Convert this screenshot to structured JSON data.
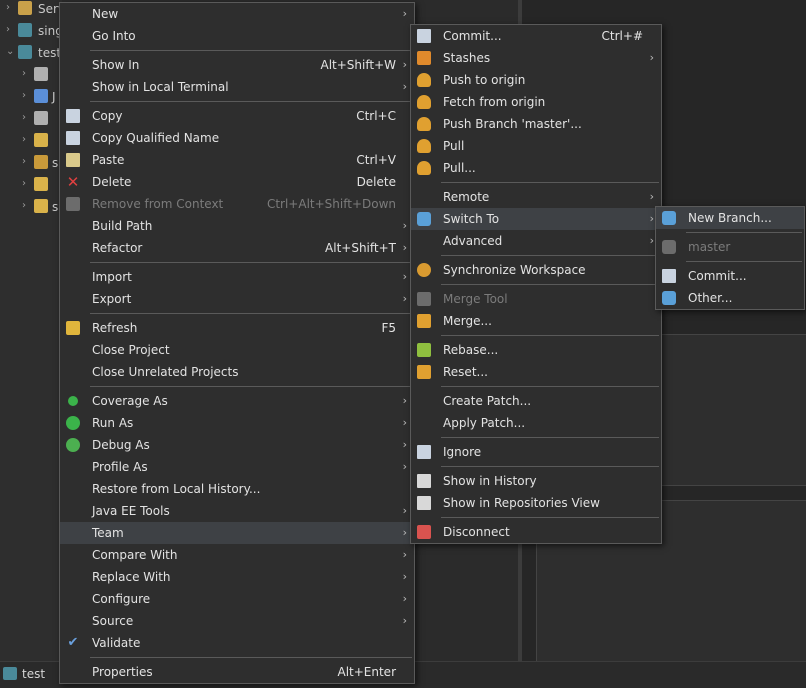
{
  "tree": [
    {
      "label": "Serv",
      "icon": "server-folder-icon"
    },
    {
      "label": "sing",
      "icon": "project-icon"
    },
    {
      "label": "test",
      "icon": "project-icon"
    },
    {
      "label": "",
      "icon": "library-icon"
    },
    {
      "label": "J",
      "icon": "java-icon"
    },
    {
      "label": "",
      "icon": "library-icon"
    },
    {
      "label": "",
      "icon": "folder-icon"
    },
    {
      "label": "s",
      "icon": "source-folder-icon"
    },
    {
      "label": "",
      "icon": "folder-icon"
    },
    {
      "label": "s",
      "icon": "folder-icon"
    }
  ],
  "status": {
    "label": "test"
  },
  "context_menu": {
    "groups": [
      [
        {
          "label": "New",
          "submenu": true
        },
        {
          "label": "Go Into"
        }
      ],
      [
        {
          "label": "Show In",
          "shortcut": "Alt+Shift+W",
          "submenu": true
        },
        {
          "label": "Show in Local Terminal",
          "submenu": true
        }
      ],
      [
        {
          "label": "Copy",
          "shortcut": "Ctrl+C",
          "icon": "copy-icon"
        },
        {
          "label": "Copy Qualified Name",
          "icon": "copy-qualified-icon"
        },
        {
          "label": "Paste",
          "shortcut": "Ctrl+V",
          "icon": "paste-icon"
        },
        {
          "label": "Delete",
          "shortcut": "Delete",
          "icon": "delete-icon"
        },
        {
          "label": "Remove from Context",
          "shortcut": "Ctrl+Alt+Shift+Down",
          "icon": "remove-context-icon",
          "disabled": true
        },
        {
          "label": "Build Path",
          "submenu": true
        },
        {
          "label": "Refactor",
          "shortcut": "Alt+Shift+T",
          "submenu": true
        }
      ],
      [
        {
          "label": "Import",
          "submenu": true
        },
        {
          "label": "Export",
          "submenu": true
        }
      ],
      [
        {
          "label": "Refresh",
          "shortcut": "F5",
          "icon": "refresh-icon"
        },
        {
          "label": "Close Project"
        },
        {
          "label": "Close Unrelated Projects"
        }
      ],
      [
        {
          "label": "Coverage As",
          "icon": "coverage-icon",
          "submenu": true
        },
        {
          "label": "Run As",
          "icon": "run-icon",
          "submenu": true
        },
        {
          "label": "Debug As",
          "icon": "debug-icon",
          "submenu": true
        },
        {
          "label": "Profile As",
          "submenu": true
        },
        {
          "label": "Restore from Local History..."
        },
        {
          "label": "Java EE Tools",
          "submenu": true
        },
        {
          "label": "Team",
          "submenu": true,
          "highlighted": true
        },
        {
          "label": "Compare With",
          "submenu": true
        },
        {
          "label": "Replace With",
          "submenu": true
        },
        {
          "label": "Configure",
          "submenu": true
        },
        {
          "label": "Source",
          "submenu": true
        },
        {
          "label": "Validate",
          "icon": "validate-check-icon"
        }
      ],
      [
        {
          "label": "Properties",
          "shortcut": "Alt+Enter"
        }
      ]
    ]
  },
  "team_menu": {
    "groups": [
      [
        {
          "label": "Commit...",
          "shortcut": "Ctrl+#",
          "icon": "commit-icon"
        },
        {
          "label": "Stashes",
          "icon": "stash-icon",
          "submenu": true
        },
        {
          "label": "Push to origin",
          "icon": "push-icon"
        },
        {
          "label": "Fetch from origin",
          "icon": "fetch-icon"
        },
        {
          "label": "Push Branch 'master'...",
          "icon": "push-branch-icon"
        },
        {
          "label": "Pull",
          "icon": "pull-icon"
        },
        {
          "label": "Pull...",
          "icon": "pull-dialog-icon"
        }
      ],
      [
        {
          "label": "Remote",
          "submenu": true
        },
        {
          "label": "Switch To",
          "icon": "switch-branch-icon",
          "submenu": true,
          "highlighted": true
        },
        {
          "label": "Advanced",
          "submenu": true
        }
      ],
      [
        {
          "label": "Synchronize Workspace",
          "icon": "synchronize-icon"
        }
      ],
      [
        {
          "label": "Merge Tool",
          "icon": "merge-tool-icon",
          "disabled": true
        },
        {
          "label": "Merge...",
          "icon": "merge-icon"
        }
      ],
      [
        {
          "label": "Rebase...",
          "icon": "rebase-icon"
        },
        {
          "label": "Reset...",
          "icon": "reset-icon"
        }
      ],
      [
        {
          "label": "Create Patch..."
        },
        {
          "label": "Apply Patch..."
        }
      ],
      [
        {
          "label": "Ignore",
          "icon": "ignore-icon"
        }
      ],
      [
        {
          "label": "Show in History",
          "icon": "history-icon"
        },
        {
          "label": "Show in Repositories View",
          "icon": "repositories-icon"
        }
      ],
      [
        {
          "label": "Disconnect",
          "icon": "disconnect-icon"
        }
      ]
    ]
  },
  "switch_menu": {
    "groups": [
      [
        {
          "label": "New Branch...",
          "icon": "new-branch-icon",
          "highlighted": true
        }
      ],
      [
        {
          "label": "master",
          "icon": "branch-icon",
          "disabled": true
        }
      ],
      [
        {
          "label": "Commit...",
          "icon": "commit-icon"
        },
        {
          "label": "Other...",
          "icon": "other-branch-icon"
        }
      ]
    ]
  }
}
